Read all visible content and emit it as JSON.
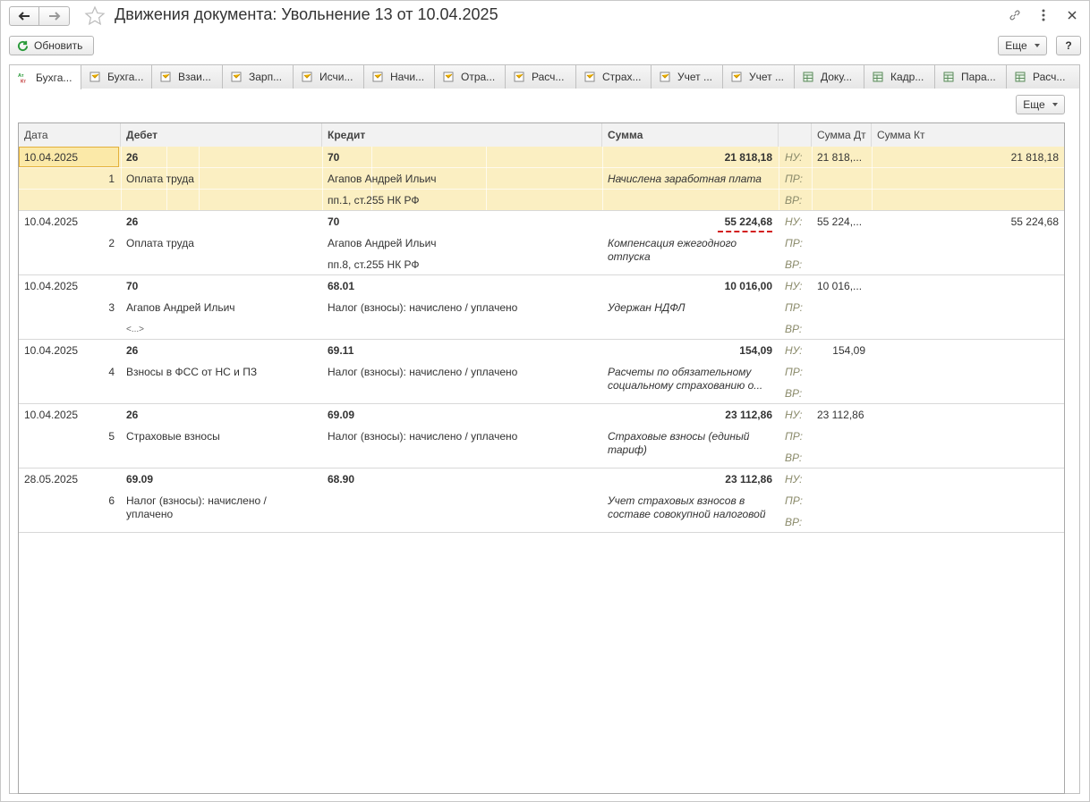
{
  "window": {
    "title": "Движения документа: Увольнение 13 от 10.04.2025"
  },
  "toolbar": {
    "refresh_label": "Обновить",
    "more_label": "Еще",
    "help_label": "?"
  },
  "tabs": [
    {
      "label": "Бухга...",
      "icon": "dt-kt-icon"
    },
    {
      "label": "Бухга...",
      "icon": "register-icon"
    },
    {
      "label": "Взаи...",
      "icon": "register-icon"
    },
    {
      "label": "Зарп...",
      "icon": "register-icon"
    },
    {
      "label": "Исчи...",
      "icon": "register-icon"
    },
    {
      "label": "Начи...",
      "icon": "register-icon"
    },
    {
      "label": "Отра...",
      "icon": "register-icon"
    },
    {
      "label": "Расч...",
      "icon": "register-icon"
    },
    {
      "label": "Страх...",
      "icon": "register-icon"
    },
    {
      "label": "Учет ...",
      "icon": "register-icon"
    },
    {
      "label": "Учет ...",
      "icon": "register-icon"
    },
    {
      "label": "Доку...",
      "icon": "table-icon"
    },
    {
      "label": "Кадр...",
      "icon": "table-icon"
    },
    {
      "label": "Пара...",
      "icon": "table-icon"
    },
    {
      "label": "Расч...",
      "icon": "table-icon"
    }
  ],
  "panel": {
    "more_label": "Еще"
  },
  "table": {
    "columns": {
      "date": "Дата",
      "debit": "Дебет",
      "credit": "Кредит",
      "sum": "Сумма",
      "sum_dt": "Сумма Дт",
      "sum_kt": "Сумма Кт"
    },
    "labels": {
      "nu": "НУ:",
      "pr": "ПР:",
      "vr": "ВР:"
    },
    "rows": [
      {
        "date": "10.04.2025",
        "num": "1",
        "debit": "26",
        "debit_sub1": "Оплата труда",
        "debit_sub2": "",
        "credit": "70",
        "credit_sub1": "Агапов Андрей Ильич",
        "credit_sub2": "пп.1, ст.255 НК РФ",
        "sum": "21 818,18",
        "content": "Начислена заработная плата",
        "sum_dt": "21 818,...",
        "sum_kt": "21 818,18"
      },
      {
        "date": "10.04.2025",
        "num": "2",
        "debit": "26",
        "debit_sub1": "Оплата труда",
        "debit_sub2": "",
        "credit": "70",
        "credit_sub1": "Агапов Андрей Ильич",
        "credit_sub2": "пп.8, ст.255 НК РФ",
        "sum": "55 224,68",
        "content": "Компенсация ежегодного отпуска",
        "sum_dt": "55 224,...",
        "sum_kt": "55 224,68"
      },
      {
        "date": "10.04.2025",
        "num": "3",
        "debit": "70",
        "debit_sub1": "Агапов Андрей Ильич",
        "debit_sub2": "<...>",
        "credit": "68.01",
        "credit_sub1": "Налог (взносы): начислено / уплачено",
        "credit_sub2": "",
        "sum": "10 016,00",
        "content": "Удержан НДФЛ",
        "sum_dt": "10 016,...",
        "sum_kt": ""
      },
      {
        "date": "10.04.2025",
        "num": "4",
        "debit": "26",
        "debit_sub1": "Взносы в ФСС от НС и ПЗ",
        "debit_sub2": "",
        "credit": "69.11",
        "credit_sub1": "Налог (взносы): начислено / уплачено",
        "credit_sub2": "",
        "sum": "154,09",
        "content": "Расчеты по обязательному социальному страхованию о...",
        "sum_dt": "154,09",
        "sum_kt": ""
      },
      {
        "date": "10.04.2025",
        "num": "5",
        "debit": "26",
        "debit_sub1": "Страховые взносы",
        "debit_sub2": "",
        "credit": "69.09",
        "credit_sub1": "Налог (взносы): начислено / уплачено",
        "credit_sub2": "",
        "sum": "23 112,86",
        "content": "Страховые взносы (единый тариф)",
        "sum_dt": "23 112,86",
        "sum_kt": ""
      },
      {
        "date": "28.05.2025",
        "num": "6",
        "debit": "69.09",
        "debit_sub1": "Налог (взносы): начислено / уплачено",
        "debit_sub2": "",
        "credit": "68.90",
        "credit_sub1": "",
        "credit_sub2": "",
        "sum": "23 112,86",
        "content": "Учет страховых взносов в составе совокупной налоговой",
        "sum_dt": "",
        "sum_kt": ""
      }
    ]
  },
  "colors": {
    "selected_row": "#fbefc2",
    "annotation_underline": "#d32020"
  }
}
